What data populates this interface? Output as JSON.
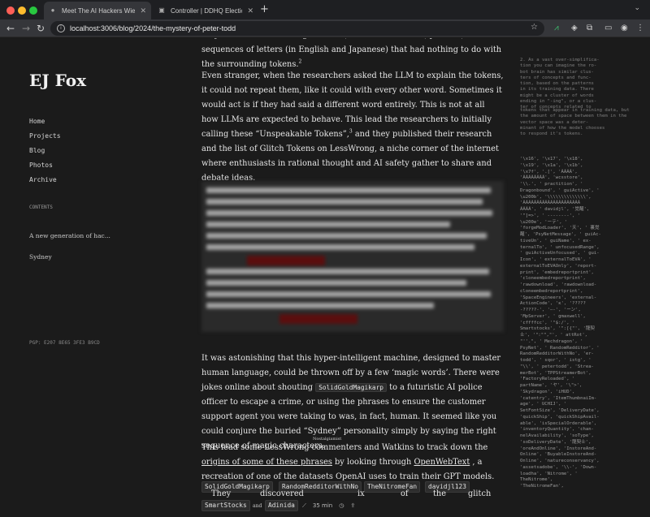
{
  "browser": {
    "tabs": [
      {
        "title": "Meet The AI Hackers Wielding",
        "active": true
      },
      {
        "title": "Controller | DDHQ Election Vi",
        "active": false
      }
    ],
    "new_tab": "+",
    "url": "localhost:3006/blog/2024/the-mystery-of-peter-todd"
  },
  "site": {
    "title": "EJ Fox",
    "nav": [
      "Home",
      "Projects",
      "Blog",
      "Photos",
      "Archive"
    ],
    "contents_label": "CONTENTS",
    "contents_items": [
      "A new generation of hac...",
      "Sydney"
    ],
    "pgp": "PGP: E207 8E65 3FE3 B9CD"
  },
  "article": {
    "p0": "they found was something different, nonsensical words, phrases, sequences of letters (in English and Japanese) that had nothing to do with the surrounding tokens.",
    "p0_ref": "2",
    "p1": "Even stranger, when the researchers asked the LLM to explain the tokens, it could not repeat them, like it could with every other word. Sometimes it would act is if they had said a different word entirely. This is not at all how LLMs are expected to behave. This lead the researchers to initially calling these “Unspeakable Tokens”,",
    "p1_ref": "3",
    "p1_tail": " and they published their research and the list of Glitch Tokens on LessWrong, a niche corner of the internet where enthusiasts in rational thought and AI safety gather to share and debate ideas.",
    "p2_a": "It was astonishing that this hyper-intelligent machine, designed to master human language, could be thrown off by a few ‘magic words’. There were jokes online about shouting ",
    "p2_code": "SolidGoldMagikarp",
    "p2_b": " to a futuristic AI police officer to escape a crime, or using the phrases to ensure the customer support agent you were taking to was, in fact, human. It seemed like you could conjure the buried “Sydney” personality simply by saying the right sequence of magic characters.",
    "p3_a": "This lead some LessWrong commenters and Watkins to track down the ",
    "p3_link1": "origins of some of these phrases",
    "p3_b": " by looking through ",
    "p3_link2": "OpenWebText",
    "p3_c": " , a recreation of one of the datasets OpenAI uses to train their GPT models.",
    "tiny_label": "Nostalgiamist",
    "chips": [
      "SolidGoldMagikarp",
      "RandomRedditorWithNo",
      "TheNitromeFan",
      "davidjl123",
      "SmartStocks",
      "Adinida"
    ],
    "overlap_words": [
      "They",
      "discovered",
      "ix",
      "of",
      "the",
      "glitch"
    ],
    "overlap_small": "and",
    "floatbar": {
      "timer": "35 min"
    }
  },
  "sidenote": {
    "text": "2. As a vast over-simplifica-\ntion you can imagine the ro-\nbot brain has similar clus-\nters of concepts and func-\ntion, based on the patterns\nin its training data. There\nmight be a cluster of words\nending in \"-ing\", or a clus-\nter of concepts related to",
    "overlap": "tokens that appear in training data, but the amount of space between them in the vector space was a deter-\nminant of how the model chooses\nto respond it's tokens.",
    "dump": "'\\x16', '\\x17', '\\x18',\n'\\x19', '\\x1a', '\\x1b',\n'\\x7f', '.[', 'ÃÃÃÃ',\n'ÃÃÃÃÃÃÃÃ', 'wcsstore',\n'\\\\.', ' practition', '\nDragonbound', ' guiActive', '\n\\u200b', '\\\\\\\\\\\\\\\\\\\\\\\\\\\\',\n'ÃÃÃÃÃÃÃÃÃÃÃÃÃÃÃÃÃÃÃÃÃ\nÃÃÃÃ', ' davidjl', '覚醒',\n'\"]=>', ' --------', '\n\\u200e', 'ーテ', '\n'forgeModLoader', '天', ' 裏覚\n醒', 'PsyNetMessage', ' guiAc-\ntiveUn', ' guiName', ' ex-\nternalTo', ' unfocusedRange',\n' guiActiveUnfocused', ' gui-\nIcon', ' externalToEVA', '\nexternalToEVAOnly', 'report-\nprint', 'embedreportprint',\n'cloneembedreportprint',\n'rawdownload', 'rawdownload-\ncloneembedreportprint',\n'SpaceEngineers', 'external-\nActionCode', 'к', '?????\n-?????-', '—-', 'ーン',\n'MpServer', ' gmaxwell',\n'cffffcc', '\"$:/', '\nSmartstocks', '\":[{\"', '龍契\n士', '\":\"\",\"', ' attRot',\n\"''.\", ' Mechdragon', '\nPsyNet', ' RandomRedditor', '\nRandomRedditorWithNo', 'er-\ntodd', ' sqor', ' istg', '\n\"\\\\', ' petertodd', 'Strea-\nmerBot', 'TPPStreamerBot',\n'FactoryReloaded', '\npartName', 'ヤ', '\\\">',\n'Skydragon', 'iHUD',\n'catentry', 'ItemThumbnaiIm-\nage', ' UCHIJ', '\nSetFontSize', 'DeliveryDate',\n'quickShip', 'quickShipAvail-\nable', 'isSpecialOrderable',\n'inventoryQuantity', 'chan-\nnelAvailability', 'soType',\n'soDeliveryDate', '龍契士',\n'oreAndOnline', 'InstoreAnd-\nOnline', 'BuyableInstoreAnd-\nOnline', 'natureconservancy',\n'assetsadobe', '\\\\-', 'Down-\nloadha', 'Nitrome', '\nTheNitrome',\n'TheNitromeFan',"
  },
  "colors": {
    "background": "#1b1b1b",
    "text": "#e6e6e6",
    "tab_active": "#35363a"
  }
}
